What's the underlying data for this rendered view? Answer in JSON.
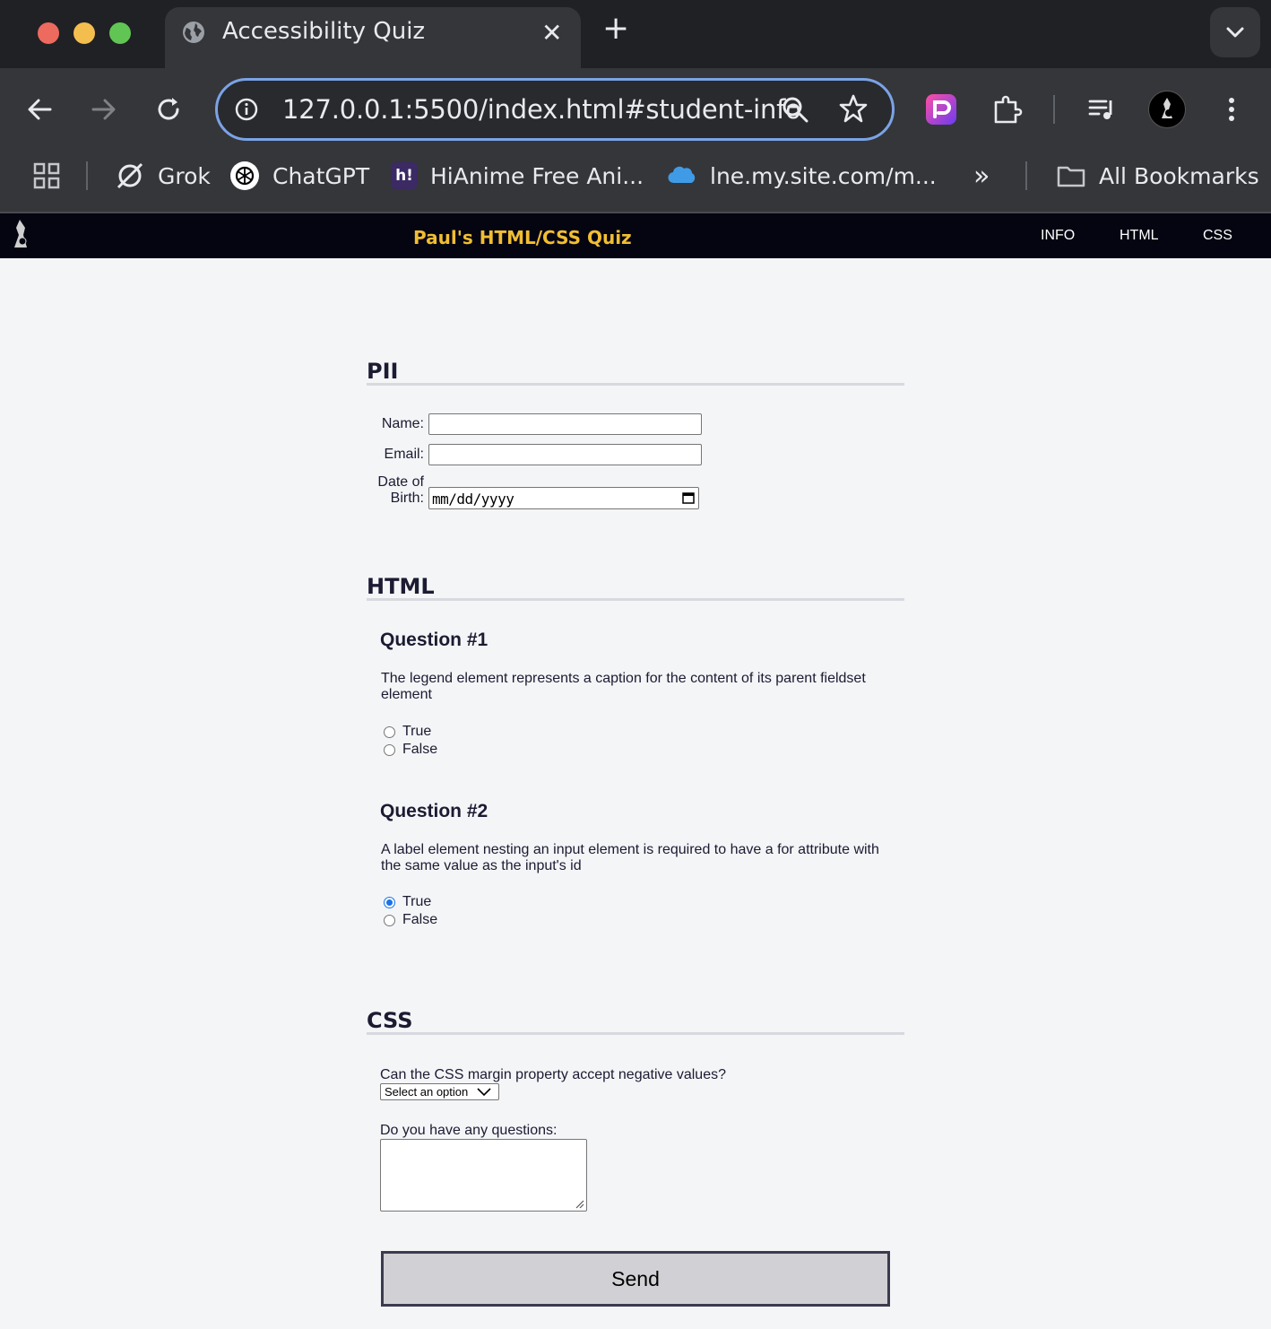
{
  "browser": {
    "tab_title": "Accessibility Quiz",
    "tab_close": "✕",
    "new_tab": "+",
    "url": "127.0.0.1:5500/index.html#student-info",
    "bookmarks": [
      {
        "label": "Grok",
        "icon": "grok-icon"
      },
      {
        "label": "ChatGPT",
        "icon": "chatgpt-icon"
      },
      {
        "label": "HiAnime Free Ani...",
        "icon": "hianime-icon",
        "badge": "h!"
      },
      {
        "label": "lne.my.site.com/m...",
        "icon": "salesforce-cloud-icon"
      }
    ],
    "overflow": "»",
    "all_bookmarks": "All Bookmarks"
  },
  "site": {
    "title": "Paul's HTML/CSS Quiz",
    "nav": [
      "INFO",
      "HTML",
      "CSS"
    ]
  },
  "sections": {
    "pii": {
      "title": "PII",
      "name_label": "Name:",
      "email_label": "Email:",
      "dob_label_1": "Date of",
      "dob_label_2": "Birth:",
      "dob_placeholder": "mm/dd/yyyy"
    },
    "html": {
      "title": "HTML",
      "q1": {
        "title": "Question #1",
        "text": "The legend element represents a caption for the content of its parent fieldset element",
        "options": [
          "True",
          "False"
        ],
        "selected": null
      },
      "q2": {
        "title": "Question #2",
        "text": "A label element nesting an input element is required to have a for attribute with the same value as the input's id",
        "options": [
          "True",
          "False"
        ],
        "selected": "True"
      }
    },
    "css": {
      "title": "CSS",
      "margin_question": "Can the CSS margin property accept negative values?",
      "select_value": "Select an option",
      "questions_label": "Do you have any questions:",
      "send_label": "Send"
    }
  },
  "colors": {
    "nav_bg": "#050512",
    "site_title": "#f1be32",
    "text": "#1b1b32",
    "radio_selected": "#1a73e8",
    "page_bg": "#f4f5f7"
  }
}
